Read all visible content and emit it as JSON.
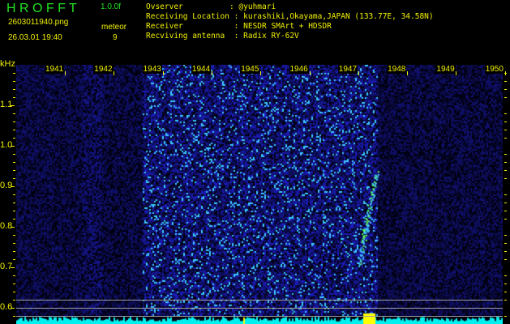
{
  "header": {
    "title": "H R O F F T",
    "version": "1.0.0f",
    "filename": "2603011940.png",
    "datetime": "26.03.01 19:40",
    "meteor_label": "meteor",
    "meteor_count": "9"
  },
  "info": {
    "observer_label": "Ovserver          :",
    "observer": "@yuhmari",
    "location_label": "Receiving Location :",
    "location": "kurashiki,Okayama,JAPAN (133.77E, 34.58N)",
    "receiver_label": "Receiver           :",
    "receiver": "NESDR SMArt + HDSDR",
    "antenna_label": "Recviving antenna  :",
    "antenna": "Radix RY-62V"
  },
  "axis": {
    "y_unit": "kHz",
    "y_ticks": [
      "1.1",
      "1.0",
      "0.9",
      "0.8",
      "0.7",
      "0.6"
    ],
    "x_ticks": [
      "1941",
      "1942",
      "1943",
      "1944",
      "1945",
      "1946",
      "1947",
      "1948",
      "1949",
      "1950"
    ]
  },
  "colors": {
    "text": "#f0f000",
    "title": "#22e022",
    "baseline": "#00f0f0",
    "meteor_marker": "#ffff00"
  }
}
